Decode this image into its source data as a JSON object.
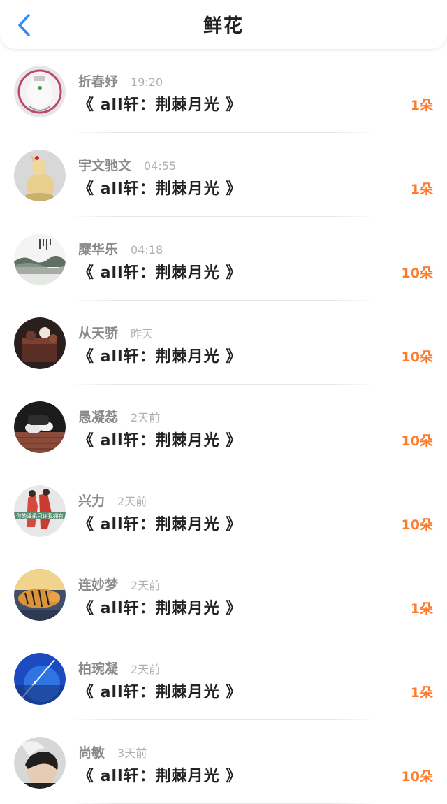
{
  "header": {
    "title": "鲜花",
    "back_icon": "chevron-left-icon",
    "accent_color": "#2f8cf0"
  },
  "colors": {
    "count": "#ff7a2a",
    "username": "#8a8a8a",
    "time": "#b0b0b0"
  },
  "gifts": [
    {
      "user": "折春妤",
      "time": "19:20",
      "book": "《 all轩：荆棘月光 》",
      "count": "1朵",
      "avatar": "mask-figure"
    },
    {
      "user": "宇文驰文",
      "time": "04:55",
      "book": "《 all轩：荆棘月光 》",
      "count": "1朵",
      "avatar": "figurine"
    },
    {
      "user": "糜华乐",
      "time": "04:18",
      "book": "《 all轩：荆棘月光 》",
      "count": "10朵",
      "avatar": "ink-landscape"
    },
    {
      "user": "从天骄",
      "time": "昨天",
      "book": "《 all轩：荆棘月光 》",
      "count": "10朵",
      "avatar": "cake"
    },
    {
      "user": "愚凝蕊",
      "time": "2天前",
      "book": "《 all轩：荆棘月光 》",
      "count": "10朵",
      "avatar": "sitting-person"
    },
    {
      "user": "兴力",
      "time": "2天前",
      "book": "《 all轩：荆棘月光 》",
      "count": "10朵",
      "avatar": "couple-text"
    },
    {
      "user": "连妙梦",
      "time": "2天前",
      "book": "《 all轩：荆棘月光 》",
      "count": "1朵",
      "avatar": "tiger"
    },
    {
      "user": "柏琬凝",
      "time": "2天前",
      "book": "《 all轩：荆棘月光 》",
      "count": "1朵",
      "avatar": "blue-sky"
    },
    {
      "user": "尚敏",
      "time": "3天前",
      "book": "《 all轩：荆棘月光 》",
      "count": "10朵",
      "avatar": "smoking-man"
    }
  ],
  "avatar_texts": {
    "couple-text": "你的温柔只许我拥有"
  }
}
